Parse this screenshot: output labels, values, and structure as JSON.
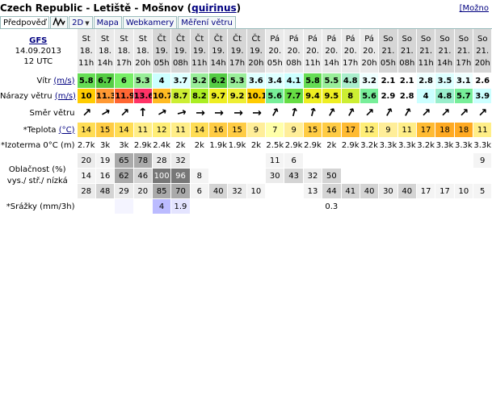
{
  "header": {
    "location": "Czech Republic - Letiště - Mošnov",
    "user": "quirinus",
    "more_label": "[Možno"
  },
  "tabs": [
    {
      "label": "Předpověď",
      "active": true
    },
    {
      "label": "∿",
      "icon": "wave-graph-icon"
    },
    {
      "label": "2D",
      "dropdown": true
    },
    {
      "label": "Mapa"
    },
    {
      "label": "Webkamery"
    },
    {
      "label": "Měření větru"
    }
  ],
  "model": {
    "name": "GFS",
    "date": "14.09.2013",
    "run": "12 UTC"
  },
  "labels": {
    "wind": "Vítr",
    "wind_unit": "(m/s)",
    "gust": "Nárazy větru",
    "gust_unit": "(m/s)",
    "direction": "Směr větru",
    "temp": "*Teplota",
    "temp_unit": "(°C)",
    "isotherm": "*Izoterma 0°C (m)",
    "cloud1": "Oblačnost (%)",
    "cloud2": "vys./ stř./ nízká",
    "precip": "*Srážky (mm/3h)"
  },
  "columns": [
    {
      "d": "St",
      "n": "18.",
      "h": "11h"
    },
    {
      "d": "St",
      "n": "18.",
      "h": "14h"
    },
    {
      "d": "St",
      "n": "18.",
      "h": "17h"
    },
    {
      "d": "St",
      "n": "18.",
      "h": "20h"
    },
    {
      "d": "Čt",
      "n": "19.",
      "h": "05h"
    },
    {
      "d": "Čt",
      "n": "19.",
      "h": "08h"
    },
    {
      "d": "Čt",
      "n": "19.",
      "h": "11h"
    },
    {
      "d": "Čt",
      "n": "19.",
      "h": "14h"
    },
    {
      "d": "Čt",
      "n": "19.",
      "h": "17h"
    },
    {
      "d": "Čt",
      "n": "19.",
      "h": "20h"
    },
    {
      "d": "Pá",
      "n": "20.",
      "h": "05h"
    },
    {
      "d": "Pá",
      "n": "20.",
      "h": "08h"
    },
    {
      "d": "Pá",
      "n": "20.",
      "h": "11h"
    },
    {
      "d": "Pá",
      "n": "20.",
      "h": "14h"
    },
    {
      "d": "Pá",
      "n": "20.",
      "h": "17h"
    },
    {
      "d": "Pá",
      "n": "20.",
      "h": "20h"
    },
    {
      "d": "So",
      "n": "21.",
      "h": "05h"
    },
    {
      "d": "So",
      "n": "21.",
      "h": "08h"
    },
    {
      "d": "So",
      "n": "21.",
      "h": "11h"
    },
    {
      "d": "So",
      "n": "21.",
      "h": "14h"
    },
    {
      "d": "So",
      "n": "21.",
      "h": "17h"
    },
    {
      "d": "So",
      "n": "21.",
      "h": "20h"
    }
  ],
  "shade_headers": [
    4,
    5,
    6,
    7,
    8,
    9,
    16,
    17,
    18,
    19,
    20,
    21
  ],
  "wind": [
    "5.8",
    "6.7",
    "6",
    "5.3",
    "4",
    "3.7",
    "5.2",
    "6.2",
    "5.3",
    "3.6",
    "3.4",
    "4.1",
    "5.8",
    "5.5",
    "4.8",
    "3.2",
    "2.1",
    "2.1",
    "2.8",
    "3.5",
    "3.1",
    "2.6"
  ],
  "wind_colors": [
    "#66dd55",
    "#55cc44",
    "#77ee66",
    "#99ee99",
    "#ccffff",
    "#ddffff",
    "#99ee99",
    "#55cc44",
    "#99ee99",
    "#ddffff",
    "#ddffff",
    "#ccffff",
    "#66dd55",
    "#99ee99",
    "#aaeecc",
    "#eeffff",
    "#ffffff",
    "#ffffff",
    "#eeffff",
    "#ddffff",
    "#eeffff",
    "#ffffff"
  ],
  "gust": [
    "10",
    "11.3",
    "11.9",
    "13.6",
    "10.7",
    "8.7",
    "8.2",
    "9.7",
    "9.2",
    "10.1",
    "5.6",
    "7.7",
    "9.4",
    "9.5",
    "8",
    "5.6",
    "2.9",
    "2.8",
    "4",
    "4.8",
    "5.7",
    "3.9"
  ],
  "gust_colors": [
    "#ffcc00",
    "#ff9933",
    "#ff6633",
    "#ff3366",
    "#ffbb22",
    "#ccee33",
    "#aaee22",
    "#eeee22",
    "#eeee33",
    "#ffcc00",
    "#77ee99",
    "#66dd44",
    "#eeee22",
    "#eeee22",
    "#ccee33",
    "#77ee99",
    "#ffffff",
    "#ffffff",
    "#ccffff",
    "#99eecc",
    "#77ee99",
    "#ccffff"
  ],
  "directions": [
    45,
    60,
    45,
    0,
    60,
    75,
    90,
    90,
    90,
    90,
    30,
    15,
    15,
    30,
    30,
    45,
    30,
    30,
    45,
    45,
    45,
    45
  ],
  "temp": [
    "14",
    "15",
    "14",
    "11",
    "12",
    "11",
    "14",
    "16",
    "15",
    "9",
    "7",
    "9",
    "15",
    "16",
    "17",
    "12",
    "9",
    "11",
    "17",
    "18",
    "18",
    "11"
  ],
  "temp_colors": [
    "#ffdd55",
    "#ffcc44",
    "#ffdd55",
    "#ffee88",
    "#ffee77",
    "#ffee88",
    "#ffdd55",
    "#ffcc44",
    "#ffcc44",
    "#ffee99",
    "#ffffaa",
    "#ffee99",
    "#ffcc44",
    "#ffcc44",
    "#ffbb33",
    "#ffee77",
    "#ffee99",
    "#ffee88",
    "#ffbb33",
    "#ffaa22",
    "#ffaa22",
    "#ffee88"
  ],
  "isotherm": [
    "2.7k",
    "3k",
    "3k",
    "2.9k",
    "2.4k",
    "2k",
    "2k",
    "1.9k",
    "1.9k",
    "2k",
    "2.5k",
    "2.9k",
    "2.9k",
    "2k",
    "2.9k",
    "3.2k",
    "3.3k",
    "3.3k",
    "3.2k",
    "3.3k",
    "3.3k",
    "3.3k"
  ],
  "cloud_high": [
    "20",
    "19",
    "65",
    "78",
    "28",
    "32",
    "",
    "",
    "",
    "",
    "11",
    "6",
    "",
    "",
    "",
    "",
    "",
    "",
    "",
    "",
    "",
    "9"
  ],
  "cloud_mid": [
    "14",
    "16",
    "62",
    "46",
    "100",
    "96",
    "8",
    "",
    "",
    "",
    "30",
    "43",
    "32",
    "50",
    "",
    "",
    "",
    "",
    "",
    "",
    "",
    ""
  ],
  "cloud_low": [
    "28",
    "48",
    "29",
    "20",
    "85",
    "70",
    "6",
    "40",
    "32",
    "10",
    "",
    "",
    "13",
    "44",
    "41",
    "40",
    "30",
    "40",
    "17",
    "17",
    "10",
    "5"
  ],
  "precip": [
    "",
    "",
    "",
    "",
    "4",
    "1.9",
    "",
    "",
    "",
    "",
    "",
    "",
    "",
    "0.3",
    "",
    "",
    "",
    "",
    "",
    "",
    "",
    ""
  ],
  "precip_colors": [
    "#ffffff",
    "#ffffff",
    "#f4f4ff",
    "#ffffff",
    "#bbbbff",
    "#e4e4ff",
    "#ffffff",
    "#ffffff",
    "#ffffff",
    "#ffffff",
    "#ffffff",
    "#ffffff",
    "#ffffff",
    "#ffffff",
    "#ffffff",
    "#ffffff",
    "#ffffff",
    "#ffffff",
    "#ffffff",
    "#ffffff",
    "#ffffff",
    "#ffffff"
  ]
}
